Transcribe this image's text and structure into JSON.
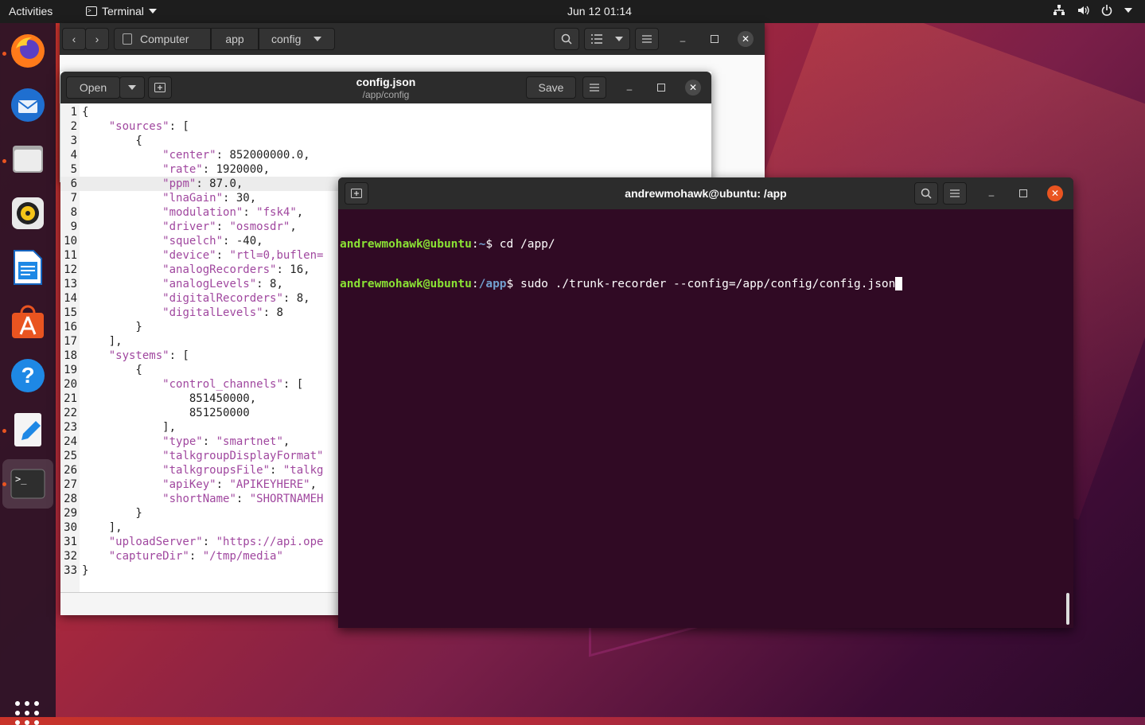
{
  "topbar": {
    "activities": "Activities",
    "app_name": "Terminal",
    "clock": "Jun 12  01:14"
  },
  "files": {
    "crumbs": [
      "Computer",
      "app",
      "config"
    ]
  },
  "editor": {
    "open_label": "Open",
    "save_label": "Save",
    "title": "config.json",
    "subtitle": "/app/config",
    "lines": [
      {
        "n": "1",
        "t": "{"
      },
      {
        "n": "2",
        "t": "    \"sources\": ["
      },
      {
        "n": "3",
        "t": "        {"
      },
      {
        "n": "4",
        "t": "            \"center\": 852000000.0,"
      },
      {
        "n": "5",
        "t": "            \"rate\": 1920000,"
      },
      {
        "n": "6",
        "t": "            \"ppm\": 87.0,"
      },
      {
        "n": "7",
        "t": "            \"lnaGain\": 30,"
      },
      {
        "n": "8",
        "t": "            \"modulation\": \"fsk4\","
      },
      {
        "n": "9",
        "t": "            \"driver\": \"osmosdr\","
      },
      {
        "n": "10",
        "t": "            \"squelch\": -40,"
      },
      {
        "n": "11",
        "t": "            \"device\": \"rtl=0,buflen="
      },
      {
        "n": "12",
        "t": "            \"analogRecorders\": 16,"
      },
      {
        "n": "13",
        "t": "            \"analogLevels\": 8,"
      },
      {
        "n": "14",
        "t": "            \"digitalRecorders\": 8,"
      },
      {
        "n": "15",
        "t": "            \"digitalLevels\": 8"
      },
      {
        "n": "16",
        "t": "        }"
      },
      {
        "n": "17",
        "t": "    ],"
      },
      {
        "n": "18",
        "t": "    \"systems\": ["
      },
      {
        "n": "19",
        "t": "        {"
      },
      {
        "n": "20",
        "t": "            \"control_channels\": ["
      },
      {
        "n": "21",
        "t": "                851450000,"
      },
      {
        "n": "22",
        "t": "                851250000"
      },
      {
        "n": "23",
        "t": "            ],"
      },
      {
        "n": "24",
        "t": "            \"type\": \"smartnet\","
      },
      {
        "n": "25",
        "t": "            \"talkgroupDisplayFormat\""
      },
      {
        "n": "26",
        "t": "            \"talkgroupsFile\": \"talkg"
      },
      {
        "n": "27",
        "t": "            \"apiKey\": \"APIKEYHERE\","
      },
      {
        "n": "28",
        "t": "            \"shortName\": \"SHORTNAMEH"
      },
      {
        "n": "29",
        "t": "        }"
      },
      {
        "n": "30",
        "t": "    ],"
      },
      {
        "n": "31",
        "t": "    \"uploadServer\": \"https://api.ope"
      },
      {
        "n": "32",
        "t": "    \"captureDir\": \"/tmp/media\""
      },
      {
        "n": "33",
        "t": "}"
      }
    ]
  },
  "terminal": {
    "title": "andrewmohawk@ubuntu: /app",
    "lines": [
      {
        "user": "andrewmohawk@ubuntu",
        "path": "~",
        "cmd": "$ cd /app/"
      },
      {
        "user": "andrewmohawk@ubuntu",
        "path": "/app",
        "cmd": "$ sudo ./trunk-recorder --config=/app/config/config.json"
      }
    ]
  }
}
